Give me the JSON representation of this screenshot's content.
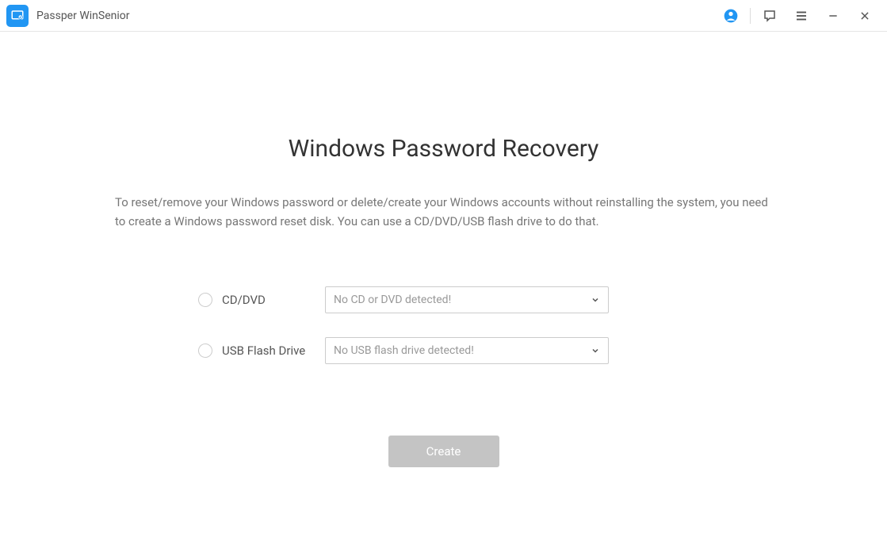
{
  "titlebar": {
    "app_title": "Passper WinSenior"
  },
  "main": {
    "heading": "Windows Password Recovery",
    "description": "To reset/remove your Windows password or delete/create your Windows accounts without reinstalling the system, you need to create a Windows password reset disk. You can use a CD/DVD/USB flash drive to do that.",
    "options": {
      "cd_dvd": {
        "label": "CD/DVD",
        "dropdown_text": "No CD or DVD detected!"
      },
      "usb": {
        "label": "USB Flash Drive",
        "dropdown_text": "No USB flash drive detected!"
      }
    },
    "create_button": "Create"
  }
}
